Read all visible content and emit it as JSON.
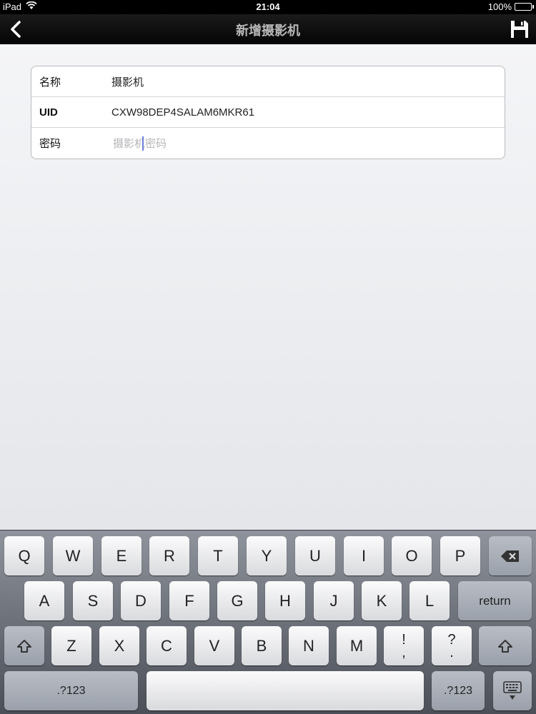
{
  "status_bar": {
    "device": "iPad",
    "time": "21:04",
    "battery": "100%"
  },
  "nav": {
    "title": "新增摄影机"
  },
  "form": {
    "name_label": "名称",
    "name_value": "摄影机",
    "uid_label": "UID",
    "uid_value": "CXW98DEP4SALAM6MKR61",
    "password_label": "密码",
    "password_placeholder": "摄影机密码"
  },
  "keyboard": {
    "row1": [
      "Q",
      "W",
      "E",
      "R",
      "T",
      "Y",
      "U",
      "I",
      "O",
      "P"
    ],
    "row2": [
      "A",
      "S",
      "D",
      "F",
      "G",
      "H",
      "J",
      "K",
      "L"
    ],
    "row3": [
      "Z",
      "X",
      "C",
      "V",
      "B",
      "N",
      "M"
    ],
    "return_label": "return",
    "exclaim_top": "!",
    "exclaim_bottom": ",",
    "question_top": "?",
    "question_bottom": ".",
    "numbers_label": ".?123",
    "numbers_label_right": ".?123"
  }
}
